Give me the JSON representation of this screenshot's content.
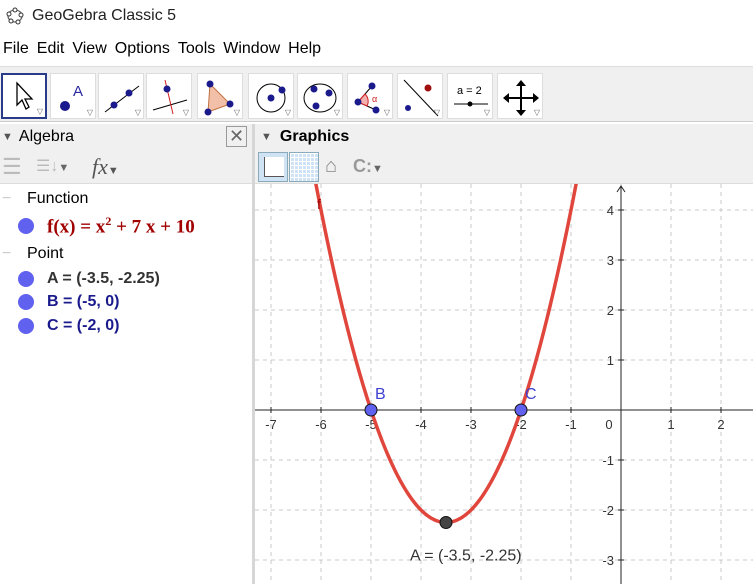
{
  "window": {
    "title": "GeoGebra Classic 5"
  },
  "menu": [
    "File",
    "Edit",
    "View",
    "Options",
    "Tools",
    "Window",
    "Help"
  ],
  "toolbar": {
    "tools": [
      "move",
      "point",
      "line",
      "perpendicular-line",
      "polygon",
      "circle-center",
      "conic-five-points",
      "angle",
      "reflect",
      "slider",
      "move-graphics-view"
    ],
    "slider_label": "a = 2",
    "angle_label": "α"
  },
  "algebra": {
    "title": "Algebra",
    "groups": [
      {
        "label": "Function",
        "items": [
          {
            "lhs": "f(x)",
            "rhs_a": "= x",
            "exp": "2",
            "rhs_b": " + 7 x + 10",
            "color": "#a00000"
          }
        ]
      },
      {
        "label": "Point",
        "items": [
          {
            "text": "A = (-3.5, -2.25)",
            "color": "#333333"
          },
          {
            "text": "B = (-5, 0)",
            "color": "#1a1a8c"
          },
          {
            "text": "C = (-2, 0)",
            "color": "#1a1a8c"
          }
        ]
      }
    ]
  },
  "graphics": {
    "title": "Graphics",
    "function": {
      "label": "f",
      "a": 1,
      "b": 7,
      "c": 10,
      "color": "#e0463c"
    },
    "points": [
      {
        "name": "A",
        "x": -3.5,
        "y": -2.25,
        "label": "A = (-3.5, -2.25)",
        "color": "#333333"
      },
      {
        "name": "B",
        "x": -5,
        "y": 0,
        "label": "B",
        "color": "#4040d0"
      },
      {
        "name": "C",
        "x": -2,
        "y": 0,
        "label": "C",
        "color": "#4040d0"
      }
    ],
    "x_ticks": [
      "-7",
      "-6",
      "-5",
      "-4",
      "-3",
      "-2",
      "-1",
      "0",
      "1",
      "2"
    ],
    "y_ticks": [
      "4",
      "3",
      "2",
      "1",
      "-1",
      "-2",
      "-3"
    ],
    "xlim": [
      -7.3,
      2.6
    ],
    "ylim": [
      -3.5,
      4.5
    ],
    "grid": true
  }
}
